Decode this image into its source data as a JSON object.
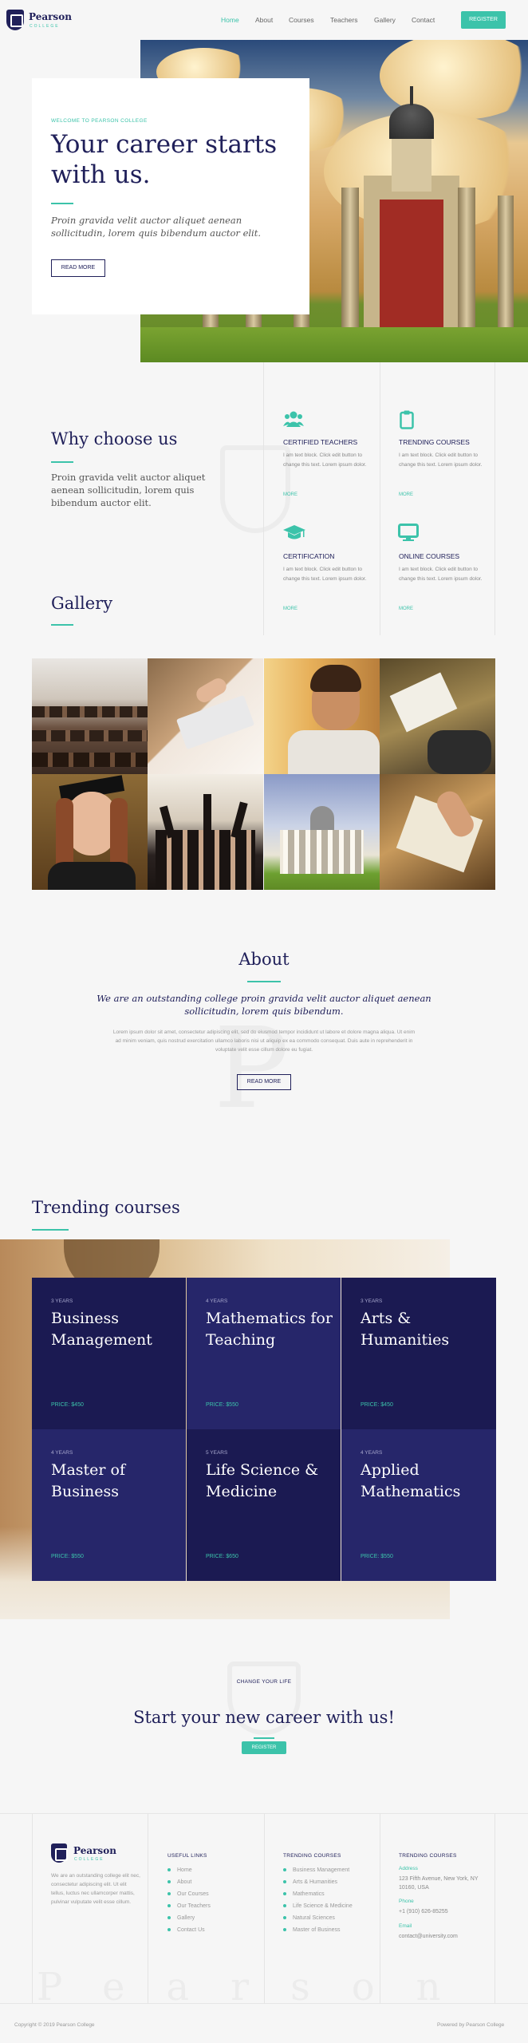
{
  "header": {
    "logo_name": "Pearson",
    "logo_sub": "COLLEGE",
    "nav": [
      "Home",
      "About",
      "Courses",
      "Teachers",
      "Gallery",
      "Contact"
    ],
    "register_label": "REGISTER"
  },
  "hero": {
    "eyebrow": "WELCOME TO PEARSON COLLEGE",
    "title": "Your career starts with us.",
    "subtitle": "Proin gravida velit auctor aliquet aenean sollicitudin, lorem quis bibendum auctor elit.",
    "button": "READ MORE"
  },
  "why": {
    "title": "Why choose us",
    "text": "Proin gravida velit auctor aliquet aenean sollicitudin, lorem quis bibendum auctor elit.",
    "features": [
      {
        "icon": "users-icon",
        "title": "CERTIFIED TEACHERS",
        "text": "I am text block. Click edit button to change this text. Lorem ipsum dolor.",
        "more": "MORE"
      },
      {
        "icon": "clipboard-icon",
        "title": "TRENDING COURSES",
        "text": "I am text block. Click edit button to change this text. Lorem ipsum dolor.",
        "more": "MORE"
      },
      {
        "icon": "graduation-cap-icon",
        "title": "CERTIFICATION",
        "text": "I am text block. Click edit button to change this text. Lorem ipsum dolor.",
        "more": "MORE"
      },
      {
        "icon": "monitor-icon",
        "title": "ONLINE COURSES",
        "text": "I am text block. Click edit button to change this text. Lorem ipsum dolor.",
        "more": "MORE"
      }
    ]
  },
  "gallery": {
    "title": "Gallery",
    "images": [
      "lecture-hall",
      "hands-laptop",
      "student-thinking",
      "reading-book",
      "graduate-smiling",
      "graduates-celebrating",
      "university-building",
      "writing-notes"
    ]
  },
  "about": {
    "title": "About",
    "lead": "We are an outstanding college proin gravida velit auctor aliquet aenean sollicitudin, lorem quis bibendum.",
    "body": "Lorem ipsum dolor sit amet, consectetur adipiscing elit, sed do eiusmod tempor incididunt ut labore et dolore magna aliqua. Ut enim ad minim veniam, quis nostrud exercitation ullamco laboris nisi ut aliquip ex ea commodo consequat. Duis aute in reprehenderit in voluptate velit esse cillum dolore eu fugiat.",
    "button": "READ MORE",
    "watermark": "P"
  },
  "courses": {
    "title": "Trending courses",
    "items": [
      {
        "years": "3 YEARS",
        "title": "Business Management",
        "price": "PRICE: $450"
      },
      {
        "years": "4 YEARS",
        "title": "Mathematics for Teaching",
        "price": "PRICE: $550"
      },
      {
        "years": "3 YEARS",
        "title": "Arts & Humanities",
        "price": "PRICE: $450"
      },
      {
        "years": "4 YEARS",
        "title": "Master of Business",
        "price": "PRICE: $550"
      },
      {
        "years": "5 YEARS",
        "title": "Life Science & Medicine",
        "price": "PRICE: $650"
      },
      {
        "years": "4 YEARS",
        "title": "Applied Mathematics",
        "price": "PRICE: $550"
      }
    ]
  },
  "cta": {
    "eyebrow": "CHANGE YOUR LIFE",
    "title": "Start your new career with us!",
    "button": "REGISTER"
  },
  "footer": {
    "about_text": "We are an outstanding college elit nec, consectetur adipiscing elit. Ut elit tellus, luctus nec ullamcorper mattis, pulvinar vulputate velit esse cillum.",
    "useful_links_title": "USEFUL LINKS",
    "useful_links": [
      "Home",
      "About",
      "Our Courses",
      "Our Teachers",
      "Gallery",
      "Contact Us"
    ],
    "trending_title": "TRENDING COURSES",
    "trending": [
      "Business Management",
      "Arts & Humanities",
      "Mathematics",
      "Life Science & Medicine",
      "Natural Sciences",
      "Master of Business"
    ],
    "contact_title": "TRENDING COURSES",
    "address_label": "Address",
    "address": "123 Fifth Avenue, New York, NY 10160, USA",
    "phone_label": "Phone",
    "phone": "+1 (910) 626-85255",
    "email_label": "Email",
    "email": "contact@university.com",
    "watermark": "Pearson",
    "copyright": "Copyright © 2019 Pearson College",
    "powered": "Powered by Pearson College"
  },
  "colors": {
    "navy": "#20205a",
    "course_dark": "#1b1a52",
    "course_light": "#26266a",
    "teal": "#3cc3aa",
    "background": "#f6f6f6"
  }
}
